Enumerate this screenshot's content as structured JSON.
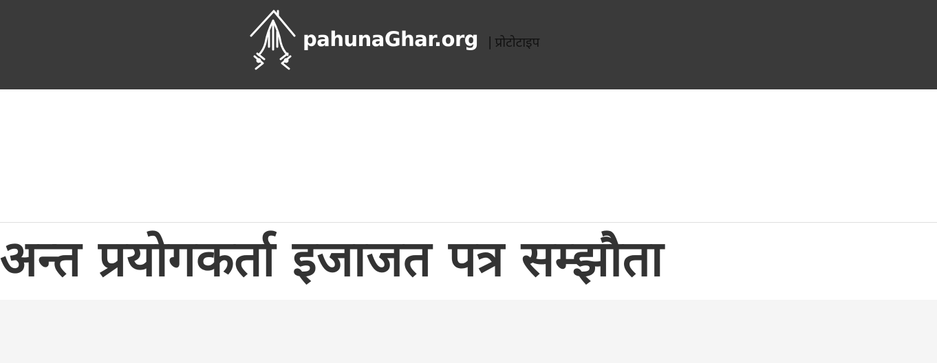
{
  "header": {
    "brand_name": "pahunaGhar.org",
    "separator": "|",
    "tagline": "प्रोटोटाइप",
    "logo_icon": "namaste-house-icon",
    "background_color": "#3a3a3a"
  },
  "page": {
    "title": "अन्त प्रयोगकर्ता इजाजत पत्र सम्झौता"
  }
}
